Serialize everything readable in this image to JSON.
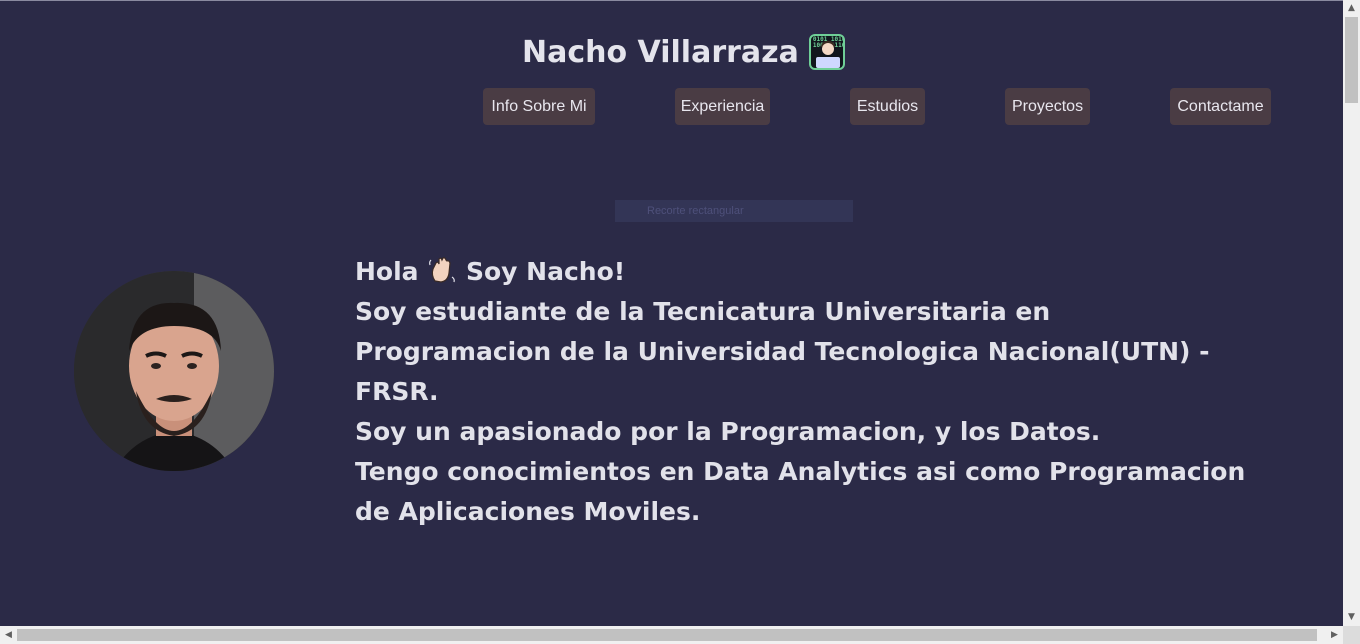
{
  "header": {
    "title": "Nacho Villarraza",
    "title_icon": "technologist-icon"
  },
  "nav": {
    "items": [
      {
        "label": "Info Sobre Mi"
      },
      {
        "label": "Experiencia"
      },
      {
        "label": "Estudios"
      },
      {
        "label": "Proyectos"
      },
      {
        "label": "Contactame"
      }
    ]
  },
  "overlay": {
    "text": "Recorte rectangular"
  },
  "intro": {
    "greeting_pre": "Hola",
    "greeting_icon": "waving-hand-icon",
    "greeting_post": "Soy Nacho!",
    "line1": "Soy estudiante de la Tecnicatura Universitaria en Programacion de la Universidad Tecnologica Nacional(UTN) - FRSR.",
    "line2": "Soy un apasionado por la Programacion, y los Datos.",
    "line3": "Tengo conocimientos en Data Analytics asi como Programacion de Aplicaciones Moviles."
  },
  "colors": {
    "background": "#2b2a47",
    "nav_button": "#4a3c44",
    "text": "#e2e2ea"
  }
}
